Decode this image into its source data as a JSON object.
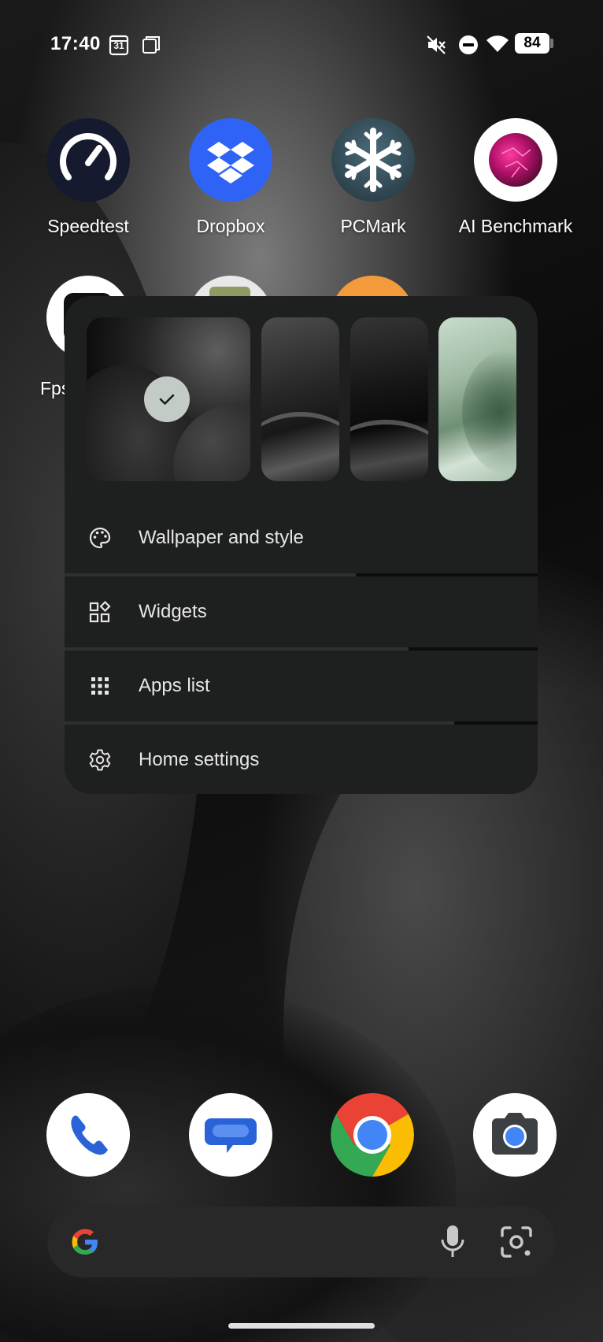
{
  "status_bar": {
    "time": "17:40",
    "calendar_date": "31",
    "battery": "84",
    "icons": [
      "calendar-icon",
      "screenshot-icon",
      "vibrate-off-icon",
      "do-not-disturb-icon",
      "wifi-icon",
      "battery-icon"
    ]
  },
  "apps_row1": [
    {
      "label": "Speedtest",
      "icon": "speedtest-icon"
    },
    {
      "label": "Dropbox",
      "icon": "dropbox-icon"
    },
    {
      "label": "PCMark",
      "icon": "pcmark-icon"
    },
    {
      "label": "AI Benchmark",
      "icon": "ai-benchmark-icon"
    }
  ],
  "apps_row2": [
    {
      "label": "Fps",
      "icon": "fps-icon"
    }
  ],
  "menu": {
    "wallpaper_thumbnails": [
      {
        "name": "wallpaper-thumb-1",
        "selected": true
      },
      {
        "name": "wallpaper-thumb-2",
        "selected": false
      },
      {
        "name": "wallpaper-thumb-3",
        "selected": false
      },
      {
        "name": "wallpaper-thumb-4",
        "selected": false
      }
    ],
    "items": [
      {
        "label": "Wallpaper and style",
        "icon": "palette-icon"
      },
      {
        "label": "Widgets",
        "icon": "widgets-icon"
      },
      {
        "label": "Apps list",
        "icon": "grid-icon"
      },
      {
        "label": "Home settings",
        "icon": "gear-icon"
      }
    ]
  },
  "dock": [
    {
      "icon": "phone-icon"
    },
    {
      "icon": "messages-icon"
    },
    {
      "icon": "chrome-icon"
    },
    {
      "icon": "camera-icon"
    }
  ],
  "search_bar": {
    "icons": [
      "google-g-icon",
      "microphone-icon",
      "lens-icon"
    ]
  },
  "colors": {
    "menu_bg": "#1e1f1f",
    "dropbox_blue": "#2f63f5",
    "google_blue": "#4285f4",
    "google_red": "#ea4335",
    "google_yellow": "#fbbc04",
    "google_green": "#34a853"
  }
}
